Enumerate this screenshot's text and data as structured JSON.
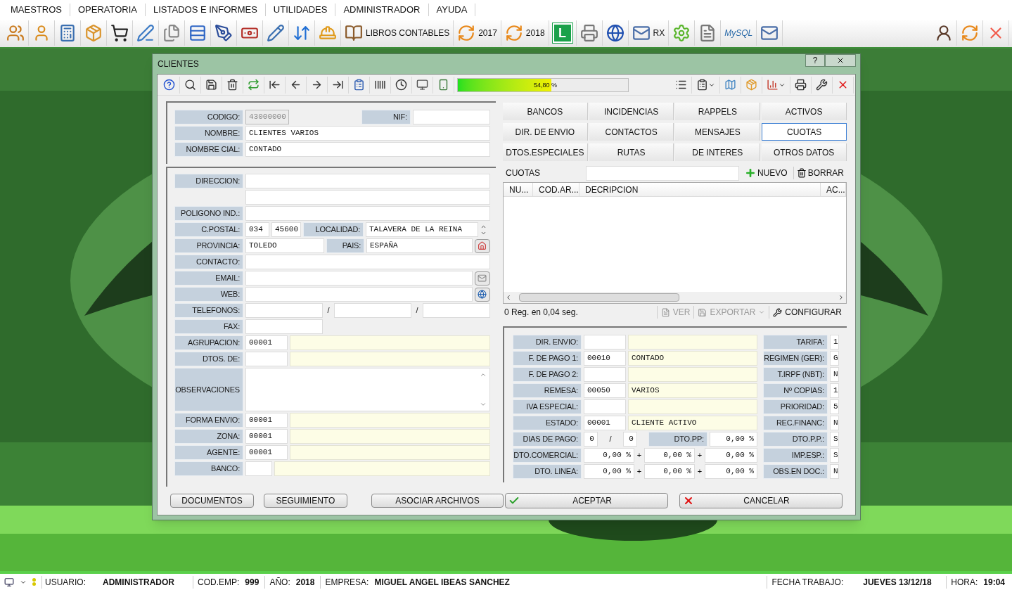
{
  "menu": [
    {
      "label": "MAESTROS"
    },
    {
      "label": "OPERATORIA"
    },
    {
      "label": "LISTADOS E INFORMES"
    },
    {
      "label": "UTILIDADES"
    },
    {
      "label": "ADMINISTRADOR"
    },
    {
      "label": "AYUDA"
    }
  ],
  "toolbar": {
    "libros": "LIBROS CONTABLES",
    "year_a": "2017",
    "year_b": "2018",
    "badge": "L",
    "rx": "RX",
    "db_logo": "MySQL"
  },
  "dialog": {
    "title": "CLIENTES",
    "help": "?"
  },
  "progress": {
    "level": 0.548,
    "reading": "54,80 %"
  },
  "general": {
    "codigo": {
      "label": "CODIGO:",
      "value": "43000000",
      "disabled": true
    },
    "nif": {
      "label": "NIF:"
    },
    "nombre": {
      "label": "NOMBRE:",
      "value": "CLIENTES VARIOS"
    },
    "nombre_cial": {
      "label": "NOMBRE CIAL:",
      "value": "CONTADO"
    }
  },
  "address": {
    "direccion": {
      "label": "DIRECCION:"
    },
    "poligono": {
      "label": "POLIGONO IND.:"
    },
    "cpostal": {
      "label": "C.POSTAL:",
      "prefix": "034",
      "value": "45600"
    },
    "localidad": {
      "label": "LOCALIDAD:",
      "value": "TALAVERA DE LA REINA"
    },
    "provincia": {
      "label": "PROVINCIA:",
      "value": "TOLEDO"
    },
    "pais": {
      "label": "PAIS:",
      "value": "ESPAÑA"
    },
    "contacto": {
      "label": "CONTACTO:"
    },
    "email": {
      "label": "EMAIL:"
    },
    "web": {
      "label": "WEB:"
    },
    "telefonos": {
      "label": "TELEFONOS:",
      "separators": [
        "/",
        "/"
      ]
    },
    "fax": {
      "label": "FAX:"
    },
    "agrupacion": {
      "label": "AGRUPACION:",
      "code": "00001"
    },
    "dtos_de": {
      "label": "DTOS. DE:"
    },
    "observaciones": {
      "label": "OBSERVACIONES"
    },
    "forma_envio": {
      "label": "FORMA ENVIO:",
      "code": "00001"
    },
    "zona": {
      "label": "ZONA:",
      "code": "00001"
    },
    "agente": {
      "label": "AGENTE:",
      "code": "00001"
    },
    "banco": {
      "label": "BANCO:"
    }
  },
  "tabs": [
    {
      "label": "BANCOS",
      "selected": false
    },
    {
      "label": "INCIDENCIAS",
      "selected": false
    },
    {
      "label": "RAPPELS",
      "selected": false
    },
    {
      "label": "ACTIVOS",
      "selected": false
    },
    {
      "label": "DIR. DE ENVIO",
      "selected": false
    },
    {
      "label": "CONTACTOS",
      "selected": false
    },
    {
      "label": "MENSAJES",
      "selected": false
    },
    {
      "label": "CUOTAS",
      "selected": true
    },
    {
      "label": "DTOS.ESPECIALES",
      "selected": false
    },
    {
      "label": "RUTAS",
      "selected": false
    },
    {
      "label": "DE INTERES",
      "selected": false
    },
    {
      "label": "OTROS DATOS",
      "selected": false
    }
  ],
  "cuotas": {
    "title": "CUOTAS",
    "new": "NUEVO",
    "delete": "BORRAR",
    "columns": [
      "NU...",
      "COD.AR...",
      "DECRIPCION",
      "AC..."
    ],
    "status": "0 Reg. en 0,04 seg.",
    "actions": [
      {
        "label": "VER",
        "disabled": true
      },
      {
        "label": "EXPORTAR",
        "disabled": true
      },
      {
        "label": "CONFIGURAR",
        "disabled": false
      }
    ]
  },
  "details": {
    "rows": [
      {
        "kind": "code",
        "label": "DIR. ENVIO:"
      },
      {
        "kind": "code",
        "label": "F. DE PAGO 1:",
        "code": "00010",
        "value": "CONTADO"
      },
      {
        "kind": "code",
        "label": "F. DE PAGO 2:"
      },
      {
        "kind": "code",
        "label": "REMESA:",
        "code": "00050",
        "value": "VARIOS"
      },
      {
        "kind": "code",
        "label": "IVA ESPECIAL:"
      },
      {
        "kind": "code",
        "label": "ESTADO:",
        "code": "00001",
        "value": "CLIENTE ACTIVO"
      },
      {
        "kind": "days",
        "label": "DIAS DE PAGO:",
        "values": [
          "0",
          "0"
        ],
        "separator": "/",
        "pp_label": "DTO.PP:",
        "pp_value": "0,00 %"
      },
      {
        "kind": "triple",
        "label": "DTO.COMERCIAL:",
        "values": [
          "0,00 %",
          "0,00 %",
          "0,00 %"
        ],
        "separators": [
          "+",
          "+"
        ]
      },
      {
        "kind": "triple",
        "label": "DTO. LINEA:",
        "values": [
          "0,00 %",
          "0,00 %",
          "0,00 %"
        ],
        "separators": [
          "+",
          "+"
        ]
      }
    ],
    "flags": [
      {
        "label": "TARIFA:",
        "value": "1"
      },
      {
        "label": "REGIMEN (GER):",
        "value": "G"
      },
      {
        "label": "T.IRPF (NBT):",
        "value": "N"
      },
      {
        "label": "Nº COPIAS:",
        "value": "1"
      },
      {
        "label": "PRIORIDAD:",
        "value": "5"
      },
      {
        "label": "REC.FINANC:",
        "value": "N"
      },
      {
        "label": "DTO.P.P.:",
        "value": "S"
      },
      {
        "label": "IMP.ESP.:",
        "value": "S"
      },
      {
        "label": "OBS.EN DOC.:",
        "value": "N"
      }
    ]
  },
  "footer": {
    "documentos": "DOCUMENTOS",
    "seguimiento": "SEGUIMIENTO",
    "asociar": "ASOCIAR ARCHIVOS",
    "aceptar": "ACEPTAR",
    "cancelar": "CANCELAR"
  },
  "status_bar": {
    "usuario_label": "USUARIO:",
    "usuario": "ADMINISTRADOR",
    "emp_label": "COD.EMP:",
    "emp": "999",
    "year_label": "AÑO:",
    "year": "2018",
    "empresa_label": "EMPRESA:",
    "empresa": "MIGUEL ANGEL IBEAS SANCHEZ",
    "fecha_label": "FECHA TRABAJO:",
    "fecha": "JUEVES 13/12/18",
    "hora_label": "HORA:",
    "hora": "19:04"
  }
}
